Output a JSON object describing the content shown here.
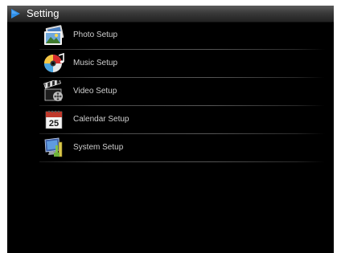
{
  "header": {
    "title": "Setting",
    "arrow_icon": "play-arrow-icon",
    "accent_color": "#2f8fe8"
  },
  "menu": {
    "items": [
      {
        "label": "Photo Setup",
        "icon": "photo-icon"
      },
      {
        "label": "Music Setup",
        "icon": "music-cd-icon"
      },
      {
        "label": "Video Setup",
        "icon": "video-clapper-icon"
      },
      {
        "label": "Calendar  Setup",
        "icon": "calendar-icon",
        "icon_text": "25"
      },
      {
        "label": "System Setup",
        "icon": "computer-monitor-icon"
      }
    ]
  }
}
